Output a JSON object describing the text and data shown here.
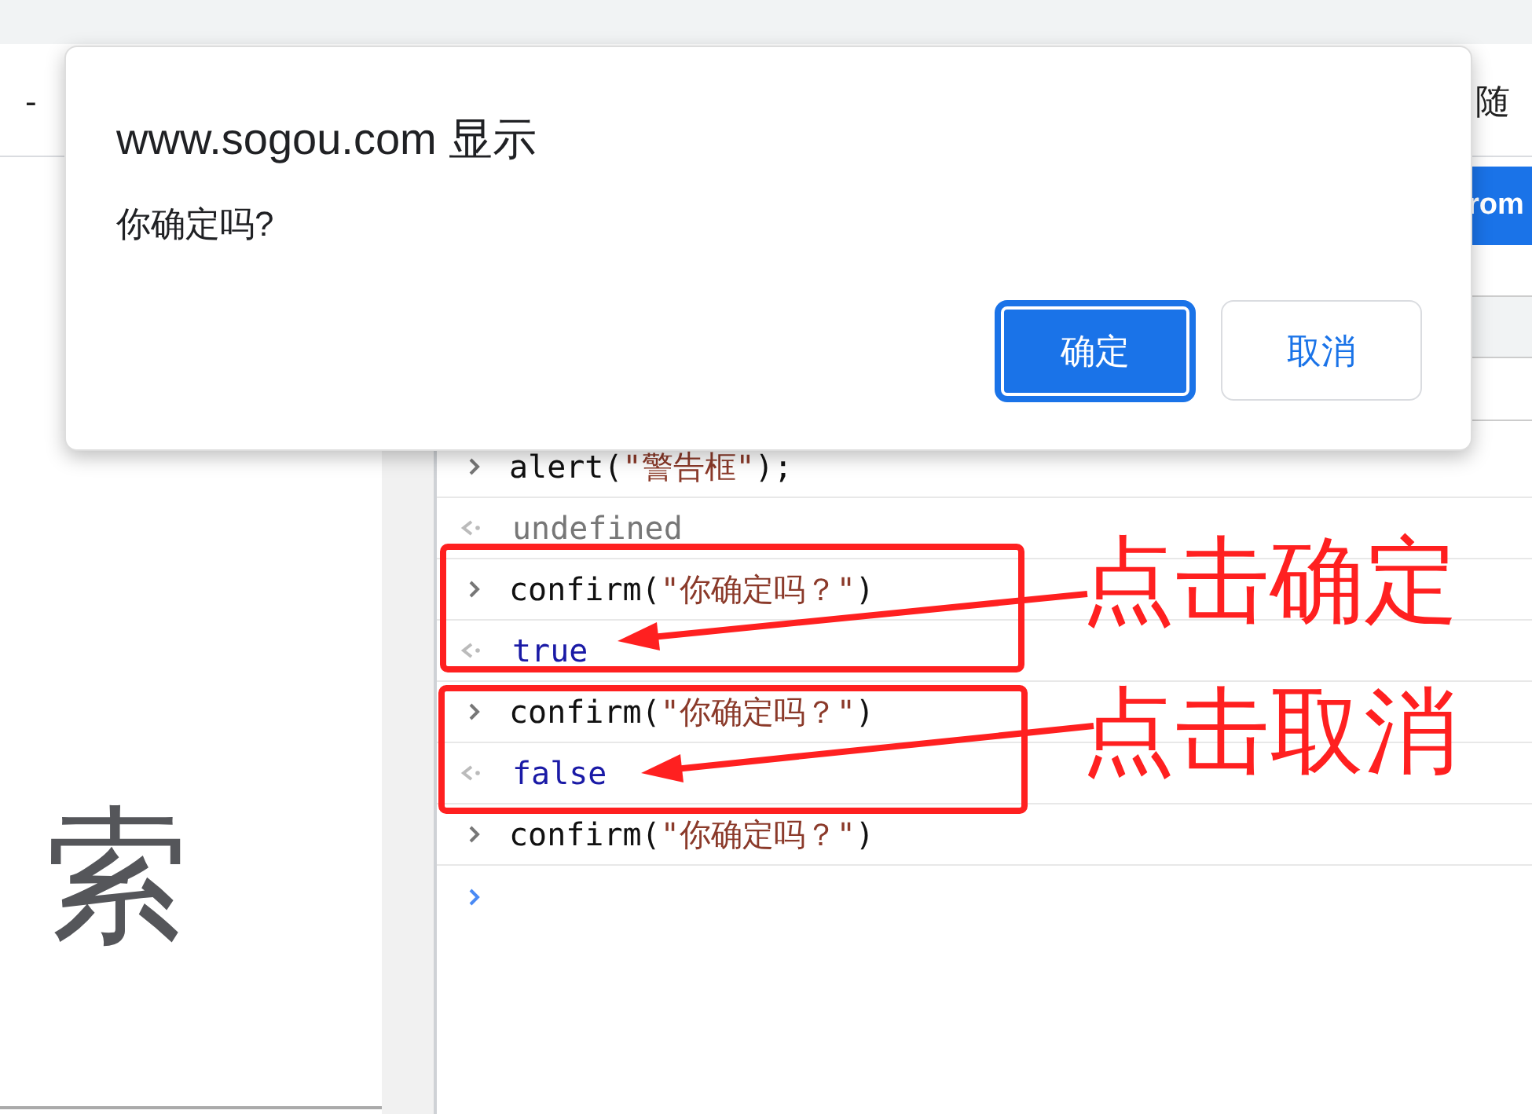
{
  "browser_tabs": [
    {
      "title": "-"
    },
    {
      "title": "随"
    }
  ],
  "toolbar": {
    "button": "rom"
  },
  "dialog": {
    "title": "www.sogou.com 显示",
    "message": "你确定吗?",
    "buttons": [
      {
        "label": "确定",
        "selected": true
      },
      {
        "label": "取消",
        "selected": false
      }
    ]
  },
  "console": {
    "lines": [
      {
        "kind": "input",
        "code": "alert(",
        "string": "\"警告框\"",
        "suffix": ");"
      },
      {
        "kind": "undefined",
        "text": "undefined"
      },
      {
        "kind": "input",
        "code": "confirm(",
        "string": "\"你确定吗？\"",
        "suffix": ")"
      },
      {
        "kind": "boolean",
        "text": "true"
      },
      {
        "kind": "input",
        "code": "confirm(",
        "string": "\"你确定吗？\"",
        "suffix": ")"
      },
      {
        "kind": "boolean",
        "text": "false"
      },
      {
        "kind": "input",
        "code": "confirm(",
        "string": "\"你确定吗？\"",
        "suffix": ")"
      },
      {
        "kind": "prompt"
      }
    ]
  },
  "page": {
    "heading": "索"
  },
  "annotations": [
    {
      "label": "点击确定"
    },
    {
      "label": "点击取消"
    }
  ]
}
